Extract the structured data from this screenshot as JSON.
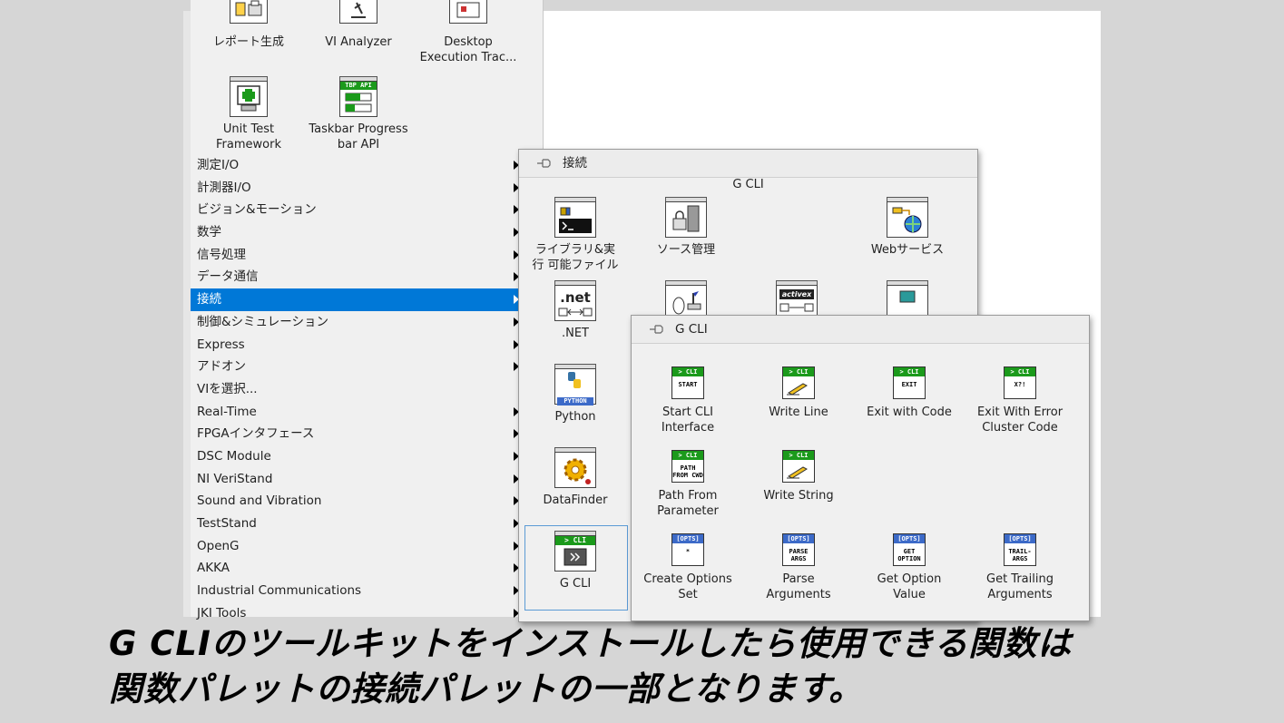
{
  "top_palette": {
    "row1": [
      "レポート生成",
      "VI Analyzer",
      "Desktop Execution Trac..."
    ],
    "row2": [
      "Unit Test Framework",
      "Taskbar Progress bar API"
    ],
    "row2_icon_banner": "TBP API"
  },
  "menu": {
    "items": [
      {
        "label": "測定I/O",
        "arrow": true
      },
      {
        "label": "計測器I/O",
        "arrow": true
      },
      {
        "label": "ビジョン&モーション",
        "arrow": true
      },
      {
        "label": "数学",
        "arrow": true
      },
      {
        "label": "信号処理",
        "arrow": true
      },
      {
        "label": "データ通信",
        "arrow": true
      },
      {
        "label": "接続",
        "arrow": true,
        "selected": true
      },
      {
        "label": "制御&シミュレーション",
        "arrow": true
      },
      {
        "label": "Express",
        "arrow": true
      },
      {
        "label": "アドオン",
        "arrow": true
      },
      {
        "label": "VIを選択...",
        "arrow": false
      },
      {
        "label": "Real-Time",
        "arrow": true
      },
      {
        "label": "FPGAインタフェース",
        "arrow": true
      },
      {
        "label": "DSC Module",
        "arrow": true
      },
      {
        "label": "NI VeriStand",
        "arrow": true
      },
      {
        "label": "Sound and Vibration",
        "arrow": true
      },
      {
        "label": "TestStand",
        "arrow": true
      },
      {
        "label": "OpenG",
        "arrow": true
      },
      {
        "label": "AKKA",
        "arrow": true
      },
      {
        "label": "Industrial Communications",
        "arrow": true
      },
      {
        "label": "JKI Tools",
        "arrow": true
      }
    ]
  },
  "connectivity_palette": {
    "title": "接続",
    "subtitle": "G CLI",
    "items": {
      "libraries": "ライブラリ&実行 可能ファイル",
      "source_control": "ソース管理",
      "web_services": "Webサービス",
      "dotnet": ".NET",
      "python": "Python",
      "datafinder": "DataFinder",
      "gcli": "G CLI"
    },
    "icon_text": {
      "dotnet": ".net",
      "activex": "activex",
      "python_banner": "PYTHON",
      "gcli_banner": "> CLI"
    }
  },
  "gcli_palette": {
    "title": "G CLI",
    "functions": [
      {
        "label": "Start CLI Interface",
        "header": "> CLI",
        "body": "START"
      },
      {
        "label": "Write Line",
        "header": "> CLI",
        "body": ""
      },
      {
        "label": "Exit with Code",
        "header": "> CLI",
        "body": "EXIT"
      },
      {
        "label": "Exit With Error Cluster Code",
        "header": "> CLI",
        "body": "X?!"
      },
      {
        "label": "Path From Parameter",
        "header": "> CLI",
        "body": "PATH FROM CWD"
      },
      {
        "label": "Write String",
        "header": "> CLI",
        "body": ""
      },
      {
        "label": "Create Options Set",
        "header": "[OPTS]",
        "body": "*"
      },
      {
        "label": "Parse Arguments",
        "header": "[OPTS]",
        "body": "PARSE ARGS"
      },
      {
        "label": "Get Option Value",
        "header": "[OPTS]",
        "body": "GET OPTION"
      },
      {
        "label": "Get Trailing Arguments",
        "header": "[OPTS]",
        "body": "TRAIL- ARGS"
      }
    ]
  },
  "caption": {
    "line1": "G CLIのツールキットをインストールしたら使用できる関数は",
    "line2": "関数パレットの接続パレットの一部となります。"
  },
  "colors": {
    "selection": "#0078d7",
    "cli_green": "#1b9a1b",
    "opts_blue": "#3c6ac8"
  }
}
